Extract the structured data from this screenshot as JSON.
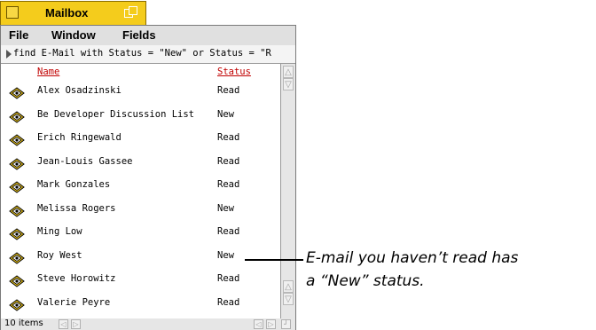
{
  "window": {
    "title": "Mailbox"
  },
  "menu": [
    "File",
    "Window",
    "Fields"
  ],
  "query": "find E-Mail with Status = \"New\" or Status = \"R",
  "columns": {
    "name": "Name",
    "status": "Status"
  },
  "rows": [
    {
      "name": "Alex Osadzinski",
      "status": "Read"
    },
    {
      "name": "Be Developer Discussion List",
      "status": "New"
    },
    {
      "name": "Erich Ringewald",
      "status": "Read"
    },
    {
      "name": "Jean-Louis Gassee",
      "status": "Read"
    },
    {
      "name": "Mark Gonzales",
      "status": "Read"
    },
    {
      "name": "Melissa Rogers",
      "status": "New"
    },
    {
      "name": "Ming Low",
      "status": "Read"
    },
    {
      "name": "Roy West",
      "status": "New"
    },
    {
      "name": "Steve Horowitz",
      "status": "Read"
    },
    {
      "name": "Valerie Peyre",
      "status": "Read"
    }
  ],
  "status_bar": {
    "count": "10 items"
  },
  "callout": {
    "line1": "E-mail you haven’t read has",
    "line2": "a “New” status."
  },
  "colors": {
    "tab": "#f4cc1c",
    "header_text": "#c00000"
  },
  "icons": {
    "mail": "envelope-icon"
  }
}
